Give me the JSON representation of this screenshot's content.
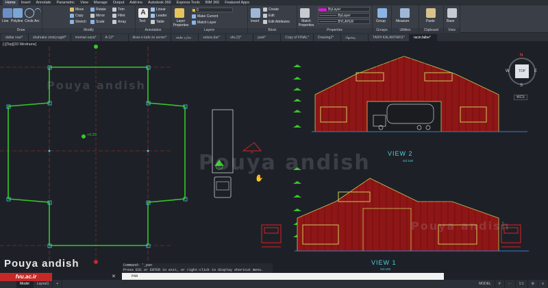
{
  "menu": [
    "Home",
    "Insert",
    "Annotate",
    "Parametric",
    "View",
    "Manage",
    "Output",
    "Add-ins",
    "Autodesk 360",
    "Express Tools",
    "BIM 360",
    "Featured Apps"
  ],
  "ribbon": {
    "draw": {
      "label": "Draw",
      "line": "Line",
      "polyline": "Polyline",
      "circle": "Circle",
      "arc": "Arc"
    },
    "modify": {
      "label": "Modify",
      "move": "Move",
      "rotate": "Rotate",
      "trim": "Trim",
      "copy": "Copy",
      "mirror": "Mirror",
      "fillet": "Fillet",
      "stretch": "Stretch",
      "scale": "Scale",
      "array": "Array"
    },
    "annotation": {
      "label": "Annotation",
      "text": "Text",
      "linear": "Linear",
      "leader": "Leader",
      "table": "Table"
    },
    "layers": {
      "label": "Layers",
      "properties": "Layer Properties",
      "make_current": "Make Current",
      "match_layer": "Match Layer"
    },
    "block": {
      "label": "Block",
      "insert": "Insert",
      "create": "Create",
      "edit": "Edit",
      "edit_attributes": "Edit Attributes"
    },
    "properties": {
      "label": "Properties",
      "match": "Match Properties",
      "color": "ByLayer",
      "linetype": "ByLayer",
      "lineweight": "BYLAYER"
    },
    "groups": {
      "label": "Groups",
      "group": "Group"
    },
    "utilities": {
      "label": "Utilities",
      "measure": "Measure"
    },
    "clipboard": {
      "label": "Clipboard",
      "paste": "Paste"
    },
    "view": {
      "label": "View",
      "base": "Base"
    }
  },
  "tabs": [
    "daftar navi*",
    "shahrake omid,naghf*",
    "memari-saza*",
    "A-12*",
    "divar-o kafe ze senier*",
    "سازه طبقه",
    "setare,dar*",
    "sfa (2)*",
    "park*",
    "Copy of FINAL*",
    "Drawing2*",
    "پیشنهاد",
    "TARH KALANTARI1*",
    "racin.falbe*"
  ],
  "active_tab": "racin.falbe*",
  "viewport": {
    "label": "[-][Top][2D Wireframe]"
  },
  "drawing": {
    "level_tag": "+0.20",
    "view2": "VIEW  2",
    "view2_scale": "Scl:100",
    "view1": "VIEW  1",
    "view1_scale": "Scl:100",
    "section_tag": "A"
  },
  "viewcube": {
    "top": "TOP",
    "n": "N",
    "s": "S",
    "e": "E",
    "w": "W",
    "wcs": "WCS"
  },
  "watermark": {
    "line1": "Pouya andish",
    "site": "fvu.ac.ir"
  },
  "command": {
    "line1": "Command: '_pan",
    "line2": "Press ESC or ENTER to exit, or right-click to display shortcut menu.",
    "prompt": "PAN"
  },
  "status_tabs": [
    "Model",
    "Layout1",
    "+"
  ],
  "status_right": {
    "model": "MODEL",
    "scale": "1:1"
  },
  "colors": {
    "accent": "#4fd0e0",
    "building": "#b01c1c",
    "frame": "#cfc85a",
    "columns": "#38c828"
  }
}
